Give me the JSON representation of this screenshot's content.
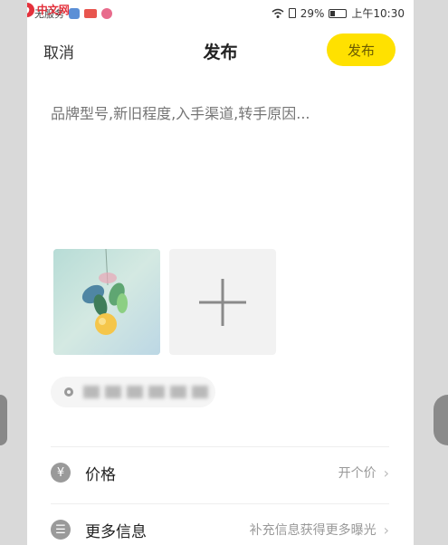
{
  "status_bar": {
    "service_text": "无服务",
    "battery_text": "29%",
    "time": "上午10:30",
    "icons": [
      "wifi-icon",
      "sim-icon",
      "battery-icon"
    ],
    "battery_level_percent": 29
  },
  "watermark": {
    "logo": "php",
    "text": "中文网"
  },
  "header": {
    "cancel_label": "取消",
    "title": "发布",
    "publish_label": "发布",
    "accent_color": "#ffe100"
  },
  "description": {
    "placeholder": "品牌型号,新旧程度,入手渠道,转手原因..."
  },
  "photos": {
    "add_icon": "plus-icon"
  },
  "list": {
    "price": {
      "icon": "yuan-icon",
      "label": "价格",
      "value": "开个价"
    },
    "more_info": {
      "icon": "list-icon",
      "label": "更多信息",
      "value": "补充信息获得更多曝光"
    }
  }
}
